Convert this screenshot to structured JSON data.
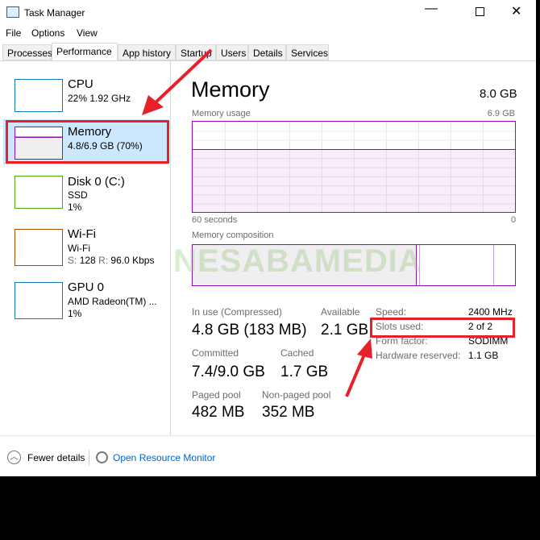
{
  "window": {
    "title": "Task Manager"
  },
  "menu": [
    "File",
    "Options",
    "View"
  ],
  "tabs": [
    "Processes",
    "Performance",
    "App history",
    "Startup",
    "Users",
    "Details",
    "Services"
  ],
  "active_tab": "Performance",
  "sidebar": [
    {
      "name": "CPU",
      "line1": "22% 1.92 GHz",
      "color": "#117dbb"
    },
    {
      "name": "Memory",
      "line1": "4.8/6.9 GB (70%)",
      "color": "#8b12ae",
      "selected": true
    },
    {
      "name": "Disk 0 (C:)",
      "line1": "SSD",
      "line2": "1%",
      "color": "#4da60c"
    },
    {
      "name": "Wi-Fi",
      "line1": "Wi-Fi",
      "line2_s": "S:",
      "line2_sv": "128",
      "line2_r": "R:",
      "line2_rv": "96.0 Kbps",
      "color": "#a74f01"
    },
    {
      "name": "GPU 0",
      "line1": "AMD Radeon(TM) ...",
      "line2": "1%",
      "color": "#117dbb"
    }
  ],
  "main": {
    "title": "Memory",
    "total": "8.0 GB",
    "usage_label": "Memory usage",
    "usage_max": "6.9 GB",
    "usage_percent": 70,
    "time_left": "60 seconds",
    "time_right": "0",
    "composition_label": "Memory composition",
    "stats": {
      "in_use_label": "In use (Compressed)",
      "in_use": "4.8 GB (183 MB)",
      "available_label": "Available",
      "available": "2.1 GB",
      "committed_label": "Committed",
      "committed": "7.4/9.0 GB",
      "cached_label": "Cached",
      "cached": "1.7 GB",
      "paged_label": "Paged pool",
      "paged": "482 MB",
      "nonpaged_label": "Non-paged pool",
      "nonpaged": "352 MB"
    },
    "specs": [
      {
        "k": "Speed:",
        "v": "2400 MHz"
      },
      {
        "k": "Slots used:",
        "v": "2 of 2"
      },
      {
        "k": "Form factor:",
        "v": "SODIMM"
      },
      {
        "k": "Hardware reserved:",
        "v": "1.1 GB"
      }
    ]
  },
  "watermark": "NESABAMEDIA",
  "footer": {
    "fewer": "Fewer details",
    "monitor": "Open Resource Monitor"
  },
  "annotation_color": "#e8202a"
}
